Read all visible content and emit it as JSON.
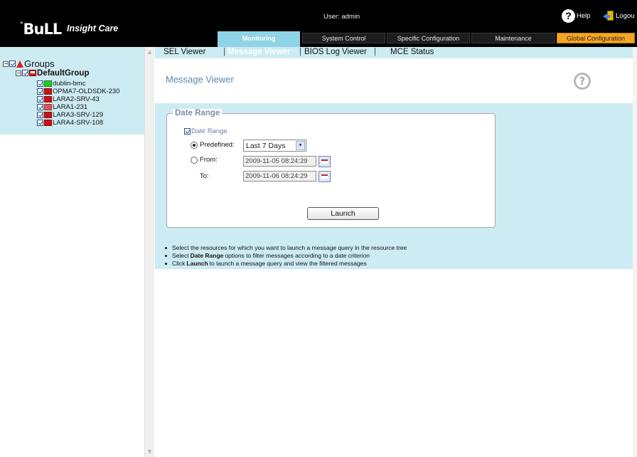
{
  "header": {
    "logo": {
      "sup": "°",
      "text": "BuLL"
    },
    "product": "Insight Care",
    "user_label": "User: admin",
    "help_label": "Help",
    "logout_label": "Logou"
  },
  "main_tabs": [
    {
      "label": "Monitoring",
      "active": true
    },
    {
      "label": "System Control"
    },
    {
      "label": "Specific Configuration"
    },
    {
      "label": "Maintenance"
    },
    {
      "label": "Global Configuration"
    }
  ],
  "tree": {
    "root": "Groups",
    "group": "DefaultGroup",
    "nodes": [
      {
        "label": "dublin-bmc",
        "status": "ok"
      },
      {
        "label": "OPMA7-OLDSDK-230",
        "status": "critical"
      },
      {
        "label": "LARA2-SRV-43",
        "status": "critical"
      },
      {
        "label": "LARA1-231",
        "status": "critical"
      },
      {
        "label": "LARA3-SRV-129",
        "status": "critical"
      },
      {
        "label": "LARA4-SRV-108",
        "status": "critical"
      }
    ]
  },
  "sub_tabs": [
    {
      "label": "SEL Viewer"
    },
    {
      "label": "Message Viewer",
      "active": true
    },
    {
      "label": "BIOS Log Viewer"
    },
    {
      "label": "MCE Status"
    }
  ],
  "page": {
    "title": "Message Viewer",
    "help_icon": "?",
    "fieldset_legend": "Date Range",
    "date_range_checkbox": "Date Range",
    "predefined_label": "Predefined:",
    "predefined_value": "Last 7 Days",
    "from_label": "From:",
    "from_value": "2009-11-05 08:24:29",
    "to_label": "To:",
    "to_value": "2009-11-06 08:24:29",
    "launch_label": "Launch",
    "instructions": [
      {
        "pre": "Select the resources for which you want to launch a message query in the resource tree",
        "bold": "",
        "post": ""
      },
      {
        "pre": "Select",
        "bold": "Date Range",
        "post": "options to filter messages according to a date criterion"
      },
      {
        "pre": "Click",
        "bold": "Launch",
        "post": "to launch a message query and view the filtered messages"
      }
    ]
  },
  "colors": {
    "header_bg": "#000000",
    "panel_bg": "#cdebf3",
    "active_tab": "#8fd3e6",
    "global_tab": "#f5a623",
    "status_ok": "#22cc22",
    "status_critical": "#cc1111",
    "title_blue": "#5b87b0"
  }
}
